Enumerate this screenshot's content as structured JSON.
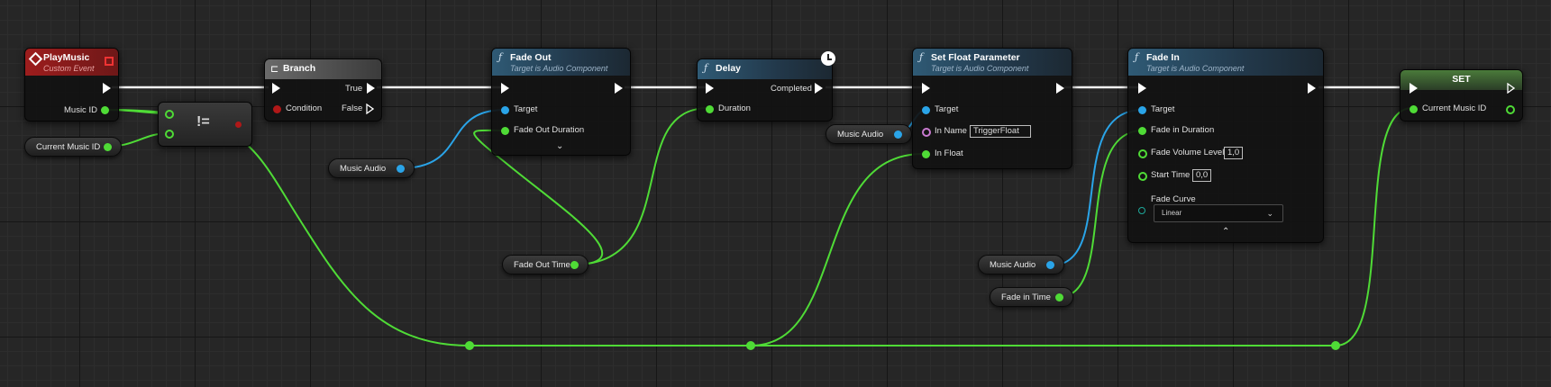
{
  "colors": {
    "exec": "#ffffff",
    "int_wire": "#4fdb36",
    "object_wire": "#2aa4e8",
    "bool_pin": "#b01818",
    "name_pin": "#c97ad0"
  },
  "event_node": {
    "title": "PlayMusic",
    "subtitle": "Custom Event",
    "pin_music_id": "Music ID"
  },
  "current_music_var": {
    "label": "Current Music ID"
  },
  "not_equal_node": {
    "symbol": "!="
  },
  "branch_node": {
    "title": "Branch",
    "pin_condition": "Condition",
    "pin_true": "True",
    "pin_false": "False"
  },
  "fade_out_node": {
    "title": "Fade Out",
    "subtitle": "Target is Audio Component",
    "pin_target": "Target",
    "pin_duration": "Fade Out Duration"
  },
  "music_audio_var_1": {
    "label": "Music Audio"
  },
  "fade_out_time_var": {
    "label": "Fade Out Time"
  },
  "delay_node": {
    "title": "Delay",
    "pin_duration": "Duration",
    "pin_completed": "Completed"
  },
  "set_float_node": {
    "title": "Set Float Parameter",
    "subtitle": "Target is Audio Component",
    "pin_target": "Target",
    "pin_in_name": "In Name",
    "in_name_value": "TriggerFloat",
    "pin_in_float": "In Float"
  },
  "music_audio_var_2": {
    "label": "Music Audio"
  },
  "fade_in_node": {
    "title": "Fade In",
    "subtitle": "Target is Audio Component",
    "pin_target": "Target",
    "pin_duration": "Fade in Duration",
    "pin_volume": "Fade Volume Level",
    "volume_value": "1,0",
    "pin_start_time": "Start Time",
    "start_time_value": "0,0",
    "pin_curve": "Fade Curve",
    "curve_value": "Linear"
  },
  "music_audio_var_3": {
    "label": "Music Audio"
  },
  "fade_in_time_var": {
    "label": "Fade in Time"
  },
  "set_node": {
    "title": "SET",
    "pin_current_music": "Current Music ID"
  }
}
